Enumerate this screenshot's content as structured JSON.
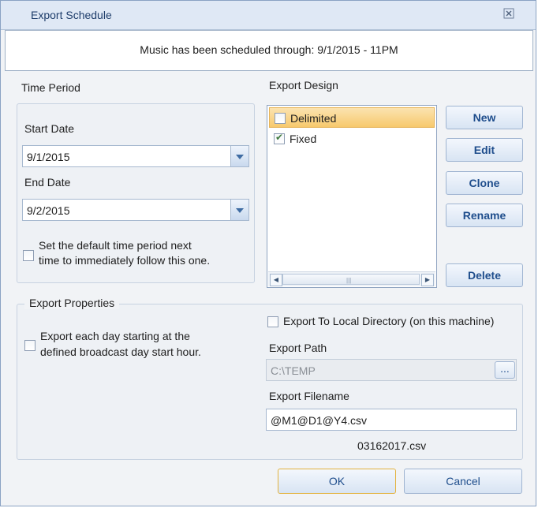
{
  "window": {
    "title": "Export Schedule"
  },
  "banner": {
    "message": "Music has been scheduled through: 9/1/2015 - 11PM"
  },
  "time_period": {
    "heading": "Time Period",
    "start_label": "Start Date",
    "start_value": "9/1/2015",
    "end_label": "End Date",
    "end_value": "9/2/2015",
    "default_line1": "Set the default time period next",
    "default_line2": "time to immediately follow this one.",
    "default_checked": false
  },
  "export_design": {
    "heading": "Export Design",
    "items": [
      {
        "label": "Delimited",
        "checked": false,
        "selected": true
      },
      {
        "label": "Fixed",
        "checked": true,
        "selected": false
      }
    ],
    "buttons": {
      "new": "New",
      "edit": "Edit",
      "clone": "Clone",
      "rename": "Rename",
      "delete": "Delete"
    }
  },
  "export_properties": {
    "heading": "Export Properties",
    "each_day_line1": "Export each day starting at the",
    "each_day_line2": "defined broadcast day start hour.",
    "local_dir_label": "Export To Local Directory (on this machine)",
    "path_label": "Export Path",
    "path_value": "C:\\TEMP",
    "browse_label": "...",
    "filename_label": "Export Filename",
    "filename_value": "@M1@D1@Y4.csv",
    "filename_preview": "03162017.csv"
  },
  "footer": {
    "ok": "OK",
    "cancel": "Cancel"
  }
}
